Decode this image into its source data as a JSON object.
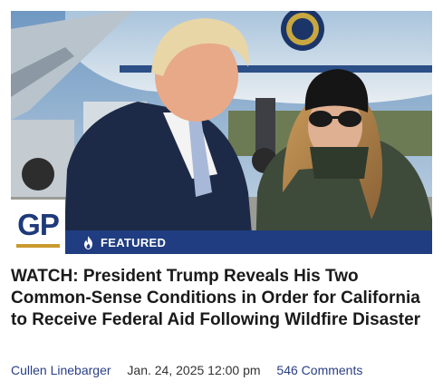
{
  "article": {
    "badge_label": "FEATURED",
    "badge_icon": "flame-icon",
    "site_logo_text": "GP",
    "headline": "WATCH: President Trump Reveals His Two Common-Sense Conditions in Order for California to Receive Federal Aid Following Wildfire Disaster",
    "author": "Cullen Linebarger",
    "date": "Jan. 24, 2025 12:00 pm",
    "comments": "546 Comments"
  },
  "colors": {
    "brand_blue": "#1f3d80",
    "link_blue": "#2a3f86",
    "logo_gold": "#c99a2e",
    "headline_text": "#1a1a1a"
  }
}
